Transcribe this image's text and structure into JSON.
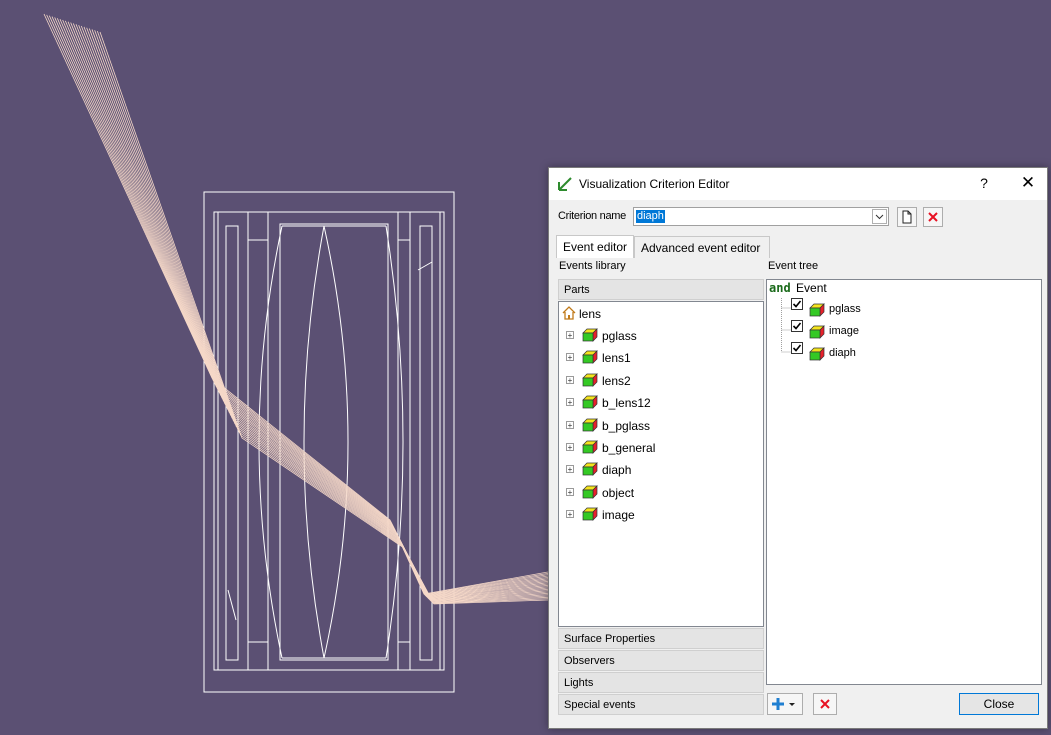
{
  "dialog": {
    "title": "Visualization Criterion Editor",
    "help_glyph": "?",
    "close_glyph": "✕",
    "criterion_label": "Criterion name",
    "criterion_value": "diaph"
  },
  "tabs": [
    {
      "label": "Event editor",
      "active": true
    },
    {
      "label": "Advanced event editor",
      "active": false
    }
  ],
  "events_library": {
    "label": "Events library",
    "sections": [
      "Parts",
      "Surface Properties",
      "Observers",
      "Lights",
      "Special events"
    ],
    "root": {
      "label": "lens",
      "icon": "home-icon"
    },
    "items": [
      "pglass",
      "lens1",
      "lens2",
      "b_lens12",
      "b_pglass",
      "b_general",
      "diaph",
      "object",
      "image"
    ]
  },
  "event_tree": {
    "label": "Event tree",
    "operator": "and",
    "root_label": "Event",
    "children": [
      {
        "label": "pglass",
        "checked": true
      },
      {
        "label": "image",
        "checked": true
      },
      {
        "label": "diaph",
        "checked": true
      }
    ]
  },
  "buttons": {
    "close_label": "Close"
  },
  "colors": {
    "viewport_background": "#5b5073",
    "ray_color": "#f5d8c8",
    "wireframe_color": "#ffffff",
    "selection_blue": "#0078d7",
    "delete_red": "#e81123",
    "part_icon_front": "#34c924",
    "part_icon_top": "#f4e41c",
    "part_icon_side": "#e8202a"
  }
}
